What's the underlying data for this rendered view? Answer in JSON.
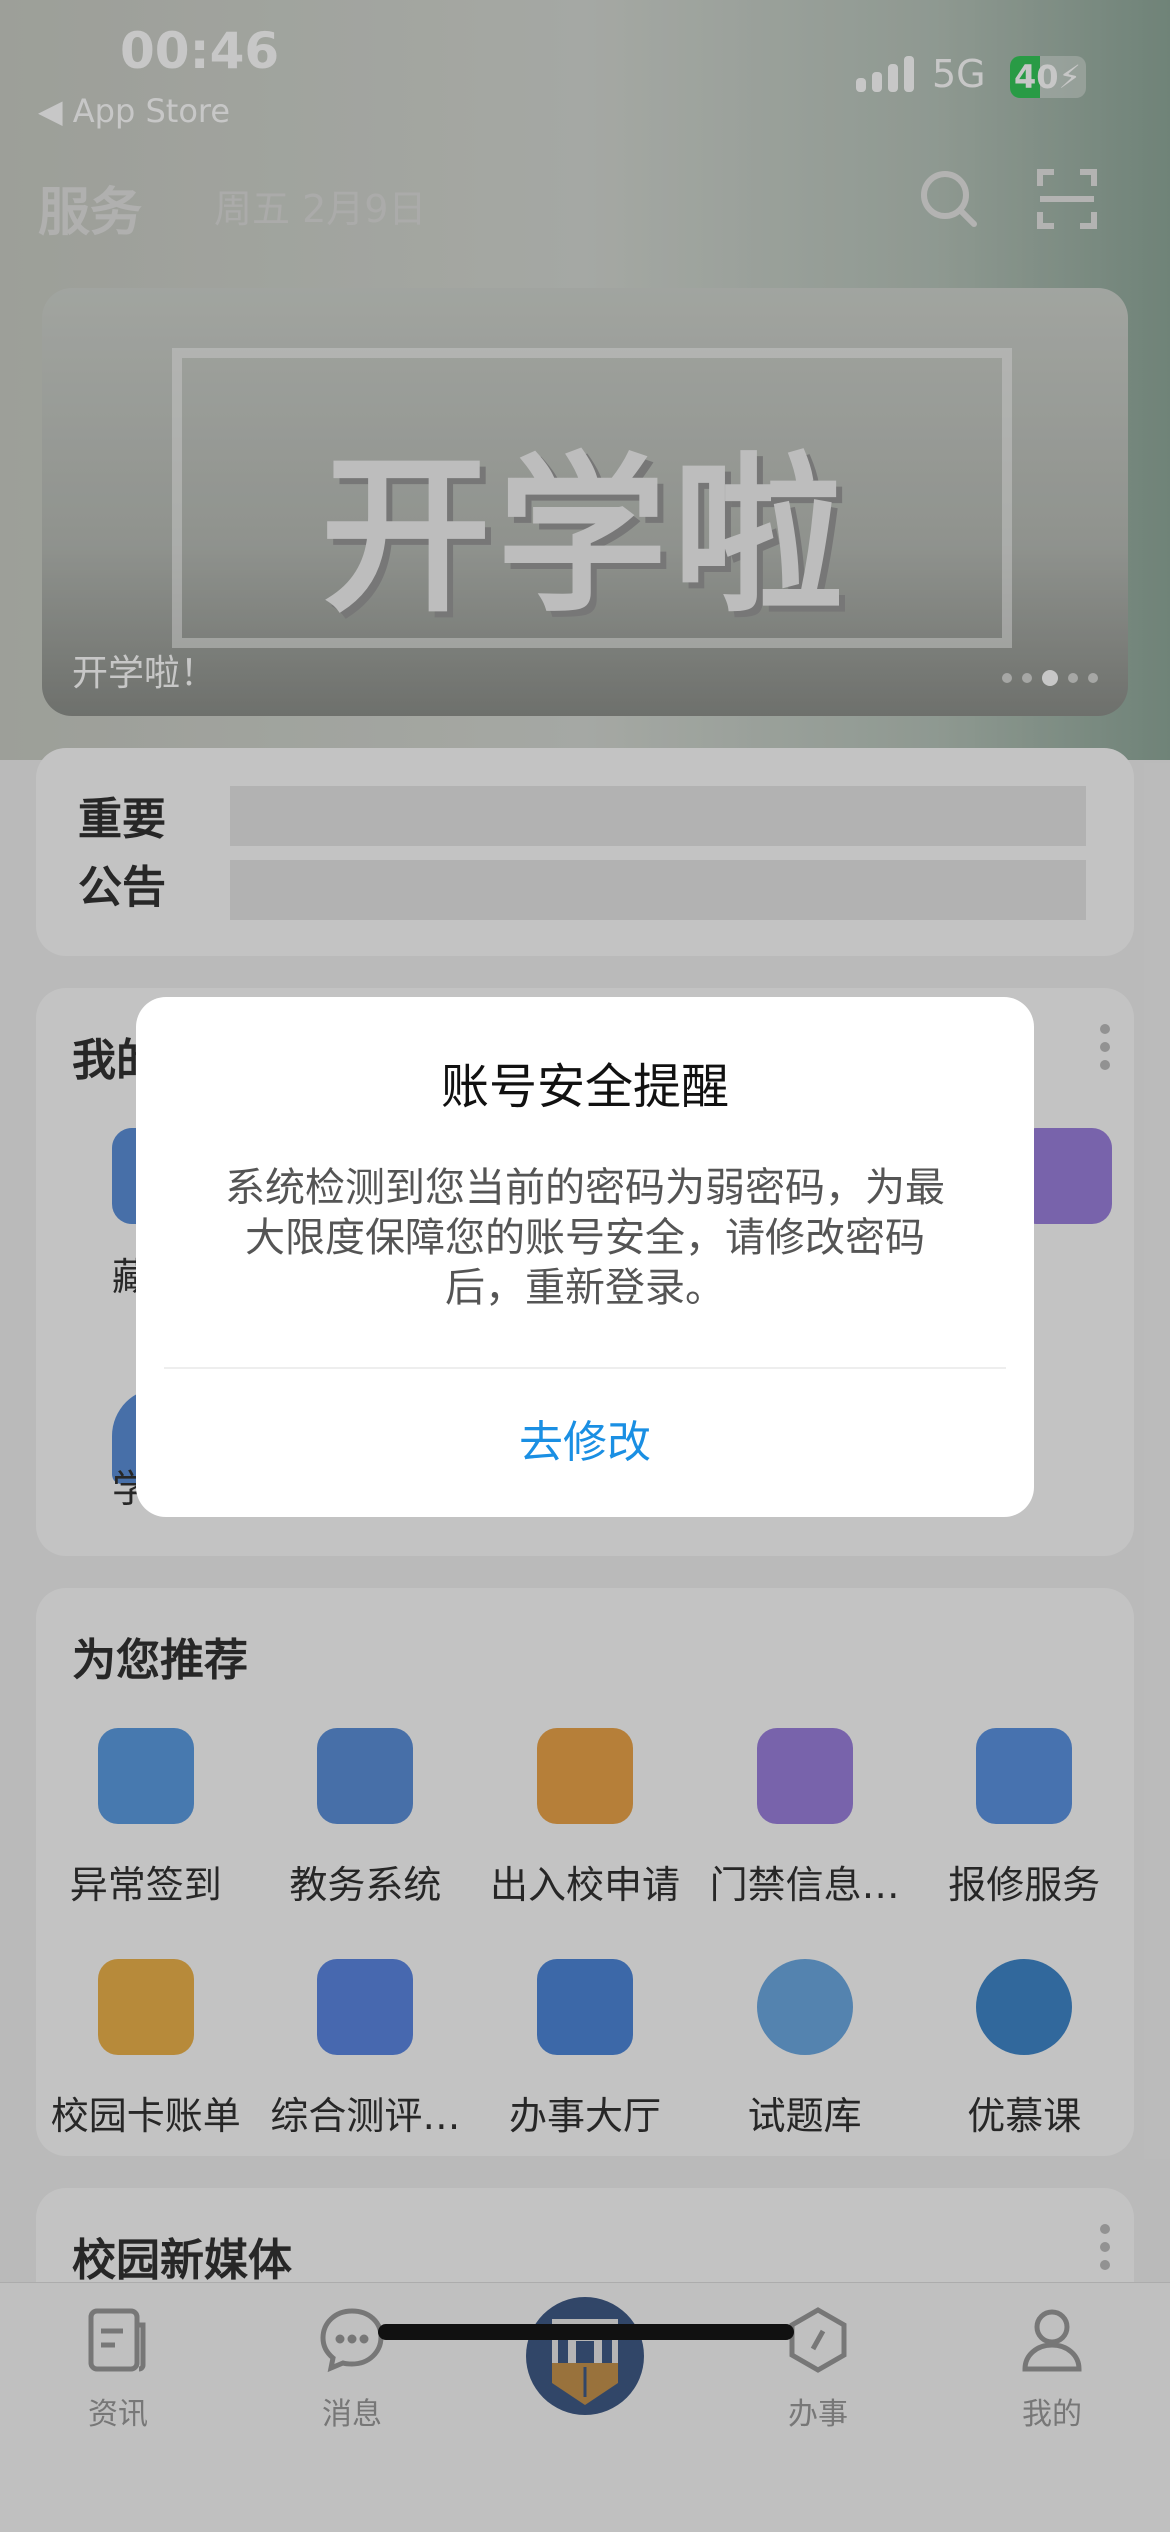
{
  "status_bar": {
    "time": "00:46",
    "back_app": "App Store",
    "network": "5G",
    "battery": "40",
    "battery_level": 0.4
  },
  "header": {
    "title": "服务",
    "date": "周五  2月9日",
    "icons": [
      "search-icon",
      "scan-icon"
    ]
  },
  "banner": {
    "art_text": "开学啦",
    "caption": "开学啦！",
    "slide_count": 5,
    "active_slide": 3
  },
  "notice": {
    "label_line1": "重要",
    "label_line2": "公告"
  },
  "my_apps": {
    "title": "我的",
    "labels": [
      "藏",
      "学"
    ]
  },
  "recommend": {
    "title": "为您推荐",
    "items": [
      {
        "label": "异常签到",
        "color": "#5b9be0"
      },
      {
        "label": "教务系统",
        "color": "#5b8fd8"
      },
      {
        "label": "出入校申请",
        "color": "#e9a34a"
      },
      {
        "label": "门禁信息…",
        "color": "#9a7fdc"
      },
      {
        "label": "报修服务",
        "color": "#5b92e0"
      },
      {
        "label": "校园卡账单",
        "color": "#ebb14b"
      },
      {
        "label": "综合测评…",
        "color": "#5b86e0"
      },
      {
        "label": "办事大厅",
        "color": "#4d86d8"
      },
      {
        "label": "试题库",
        "color": "#6ca8e0"
      },
      {
        "label": "优慕课",
        "color": "#3f86c8"
      }
    ]
  },
  "media": {
    "title": "校园新媒体"
  },
  "tabbar": {
    "items": [
      {
        "label": "资讯",
        "icon": "news-icon"
      },
      {
        "label": "消息",
        "icon": "message-icon"
      },
      {
        "label": "办事",
        "icon": "compass-icon"
      },
      {
        "label": "我的",
        "icon": "user-icon"
      }
    ]
  },
  "dialog": {
    "title": "账号安全提醒",
    "body_line1": "系统检测到您当前的密码为弱密码，为最",
    "body_line2": "大限度保障您的账号安全，请修改密码",
    "body_line3": "后，重新登录。",
    "button": "去修改",
    "button_color": "#1a8fe3"
  }
}
